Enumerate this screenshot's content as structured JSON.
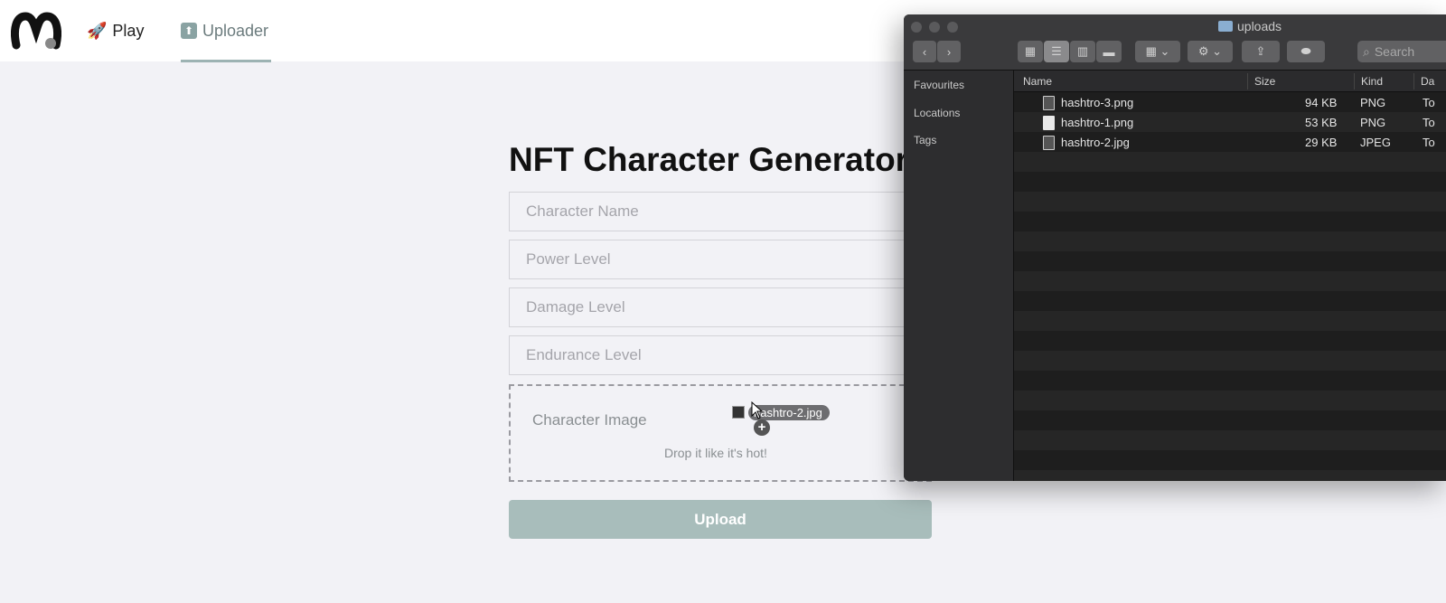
{
  "nav": {
    "items": [
      {
        "icon": "rocket-icon",
        "label": "Play"
      },
      {
        "icon": "upload-box-icon",
        "label": "Uploader"
      }
    ]
  },
  "form": {
    "title": "NFT Character Generator",
    "fields": {
      "name_placeholder": "Character Name",
      "power_placeholder": "Power Level",
      "damage_placeholder": "Damage Level",
      "endurance_placeholder": "Endurance Level"
    },
    "dropzone": {
      "label": "Character Image",
      "hint": "Drop it like it's hot!"
    },
    "upload_label": "Upload"
  },
  "drag": {
    "filename": "hashtro-2.jpg",
    "badge": "+"
  },
  "finder": {
    "title": "uploads",
    "search_placeholder": "Search",
    "sidebar": [
      "Favourites",
      "Locations",
      "Tags"
    ],
    "columns": [
      "Name",
      "Size",
      "Kind",
      "Da"
    ],
    "files": [
      {
        "name": "hashtro-3.png",
        "size": "94 KB",
        "kind": "PNG",
        "date": "To"
      },
      {
        "name": "hashtro-1.png",
        "size": "53 KB",
        "kind": "PNG",
        "date": "To"
      },
      {
        "name": "hashtro-2.jpg",
        "size": "29 KB",
        "kind": "JPEG",
        "date": "To"
      }
    ]
  },
  "colors": {
    "accent": "#a8bdbb",
    "nav_active": "#6b7b7d",
    "finder_bg": "#1e1e1e"
  }
}
